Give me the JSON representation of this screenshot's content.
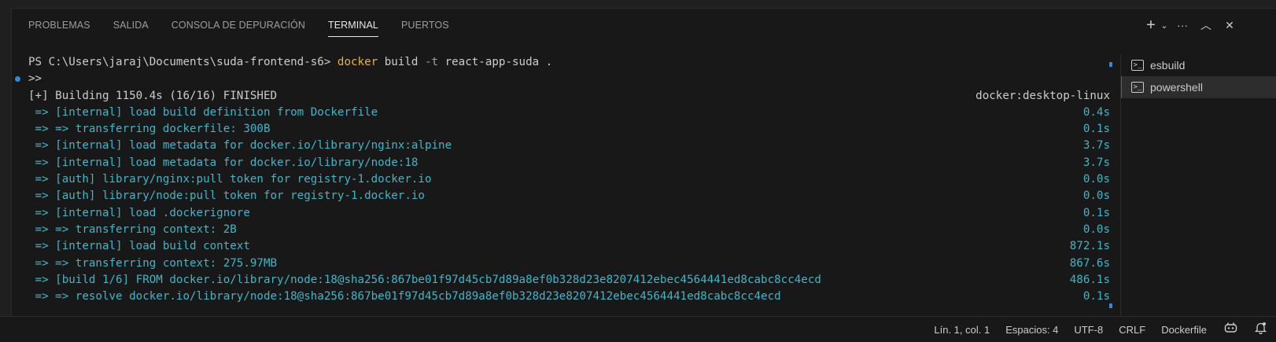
{
  "tabs": [
    {
      "label": "PROBLEMAS"
    },
    {
      "label": "SALIDA"
    },
    {
      "label": "CONSOLA DE DEPURACIÓN"
    },
    {
      "label": "TERMINAL"
    },
    {
      "label": "PUERTOS"
    }
  ],
  "actions": {
    "new_terminal": "+",
    "dropdown": "⌄",
    "more": "···",
    "maximize": "︿",
    "close": "✕"
  },
  "terminal": {
    "prompt": "PS C:\\Users\\jaraj\\Documents\\suda-frontend-s6> ",
    "cmd_name": "docker",
    "cmd_rest": " build ",
    "cmd_flag": "-t",
    "cmd_args": " react-app-suda .",
    "continuation": ">>",
    "building": "[+] Building 1150.4s (16/16) FINISHED",
    "building_right": "docker:desktop-linux",
    "steps": [
      {
        "text": " => [internal] load build definition from Dockerfile",
        "time": "0.4s"
      },
      {
        "text": " => => transferring dockerfile: 300B",
        "time": "0.1s"
      },
      {
        "text": " => [internal] load metadata for docker.io/library/nginx:alpine",
        "time": "3.7s"
      },
      {
        "text": " => [internal] load metadata for docker.io/library/node:18",
        "time": "3.7s"
      },
      {
        "text": " => [auth] library/nginx:pull token for registry-1.docker.io",
        "time": "0.0s"
      },
      {
        "text": " => [auth] library/node:pull token for registry-1.docker.io",
        "time": "0.0s"
      },
      {
        "text": " => [internal] load .dockerignore",
        "time": "0.1s"
      },
      {
        "text": " => => transferring context: 2B",
        "time": "0.0s"
      },
      {
        "text": " => [internal] load build context",
        "time": "872.1s"
      },
      {
        "text": " => => transferring context: 275.97MB",
        "time": "867.6s"
      },
      {
        "text": " => [build 1/6] FROM docker.io/library/node:18@sha256:867be01f97d45cb7d89a8ef0b328d23e8207412ebec4564441ed8cabc8cc4ecd",
        "time": "486.1s"
      },
      {
        "text": " => => resolve docker.io/library/node:18@sha256:867be01f97d45cb7d89a8ef0b328d23e8207412ebec4564441ed8cabc8cc4ecd",
        "time": "0.1s"
      }
    ]
  },
  "terminals": [
    {
      "label": "esbuild",
      "icon": "terminal-icon"
    },
    {
      "label": "powershell",
      "icon": "terminal-icon"
    }
  ],
  "status": {
    "position": "Lín. 1, col. 1",
    "spaces": "Espacios: 4",
    "encoding": "UTF-8",
    "eol": "CRLF",
    "language": "Dockerfile"
  },
  "colors": {
    "accent": "#0078d4",
    "cyan": "#3fb6c9",
    "command": "#e3b341"
  }
}
